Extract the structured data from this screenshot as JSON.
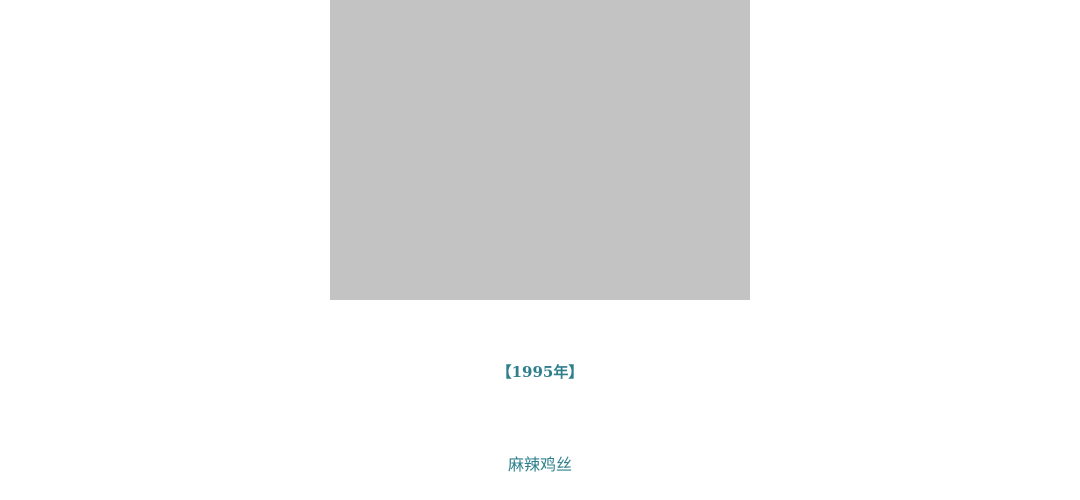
{
  "article": {
    "year_heading": "【1995年】",
    "dish_caption": "麻辣鸡丝"
  },
  "colors": {
    "accent_text": "#2e7f8c",
    "image_placeholder": "#c3c3c3",
    "background": "#ffffff"
  }
}
